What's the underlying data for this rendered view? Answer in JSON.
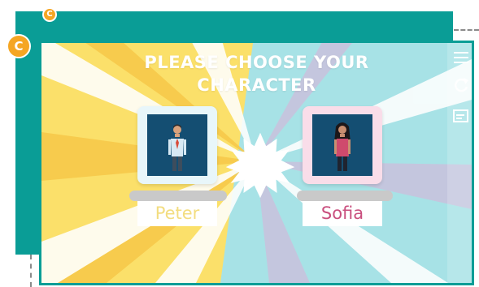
{
  "title": "PLEASE CHOOSE YOUR\nCHARACTER",
  "characters": [
    {
      "name": "Peter",
      "name_color": "#f3dd80",
      "card_color": "#e8f6fa"
    },
    {
      "name": "Sofia",
      "name_color": "#c94f7e",
      "card_color": "#f9dde9"
    }
  ],
  "colors": {
    "frame": "#0a9d96",
    "yellow_bg": "#fbe06a",
    "blue_bg": "#a7e2e6",
    "lilac_ray": "#c9c3dd",
    "coin": "#f5a623",
    "portrait_bg": "#144e72"
  },
  "icons": {
    "menu": "menu-icon",
    "restart": "restart-icon",
    "subtitles": "subtitles-icon",
    "coin": "coin-icon",
    "burst": "burst-icon"
  },
  "coin_symbol": "C"
}
